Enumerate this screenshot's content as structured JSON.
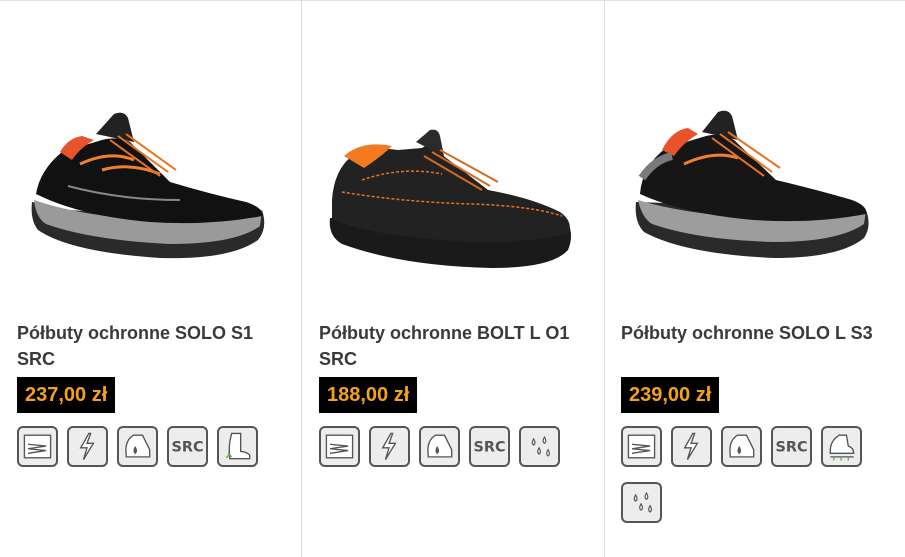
{
  "products": [
    {
      "title": "Półbuty ochronne SOLO S1 SRC",
      "price": "237,00 zł",
      "shoe_style": "suede-black",
      "icons": [
        "antistatic-sole-icon",
        "lightning-icon",
        "heel-energy-icon",
        "src-icon",
        "boot-puncture-icon"
      ]
    },
    {
      "title": "Półbuty ochronne BOLT L O1 SRC",
      "price": "188,00 zł",
      "shoe_style": "leather-orange",
      "icons": [
        "antistatic-sole-icon",
        "lightning-icon",
        "heel-energy-icon",
        "src-icon",
        "water-drops-icon"
      ]
    },
    {
      "title": "Półbuty ochronne SOLO L S3",
      "price": "239,00 zł",
      "shoe_style": "leather-black",
      "icons": [
        "antistatic-sole-icon",
        "lightning-icon",
        "heel-energy-icon",
        "src-icon",
        "shoe-puncture-icon",
        "water-drops-icon"
      ]
    }
  ],
  "icon_src_text": "SRC",
  "colors": {
    "price_bg": "#000000",
    "price_text": "#f5a21b",
    "icon_border": "#555555",
    "icon_bg": "#ededed"
  }
}
